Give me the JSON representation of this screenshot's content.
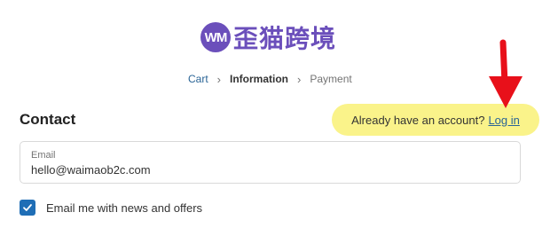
{
  "logo": {
    "badge_text": "WM",
    "brand_text": "歪猫跨境",
    "brand_color": "#6b4fbb"
  },
  "breadcrumb": {
    "items": [
      "Cart",
      "Information",
      "Payment"
    ],
    "separator_icon": "chevron-right-icon"
  },
  "contact": {
    "heading": "Contact",
    "account_prompt": "Already have an account?",
    "login_label": "Log in",
    "highlight_color": "#faf38a",
    "annotation_arrow_color": "#e8101a"
  },
  "email": {
    "label": "Email",
    "value": "hello@waimaob2c.com"
  },
  "newsletter": {
    "label": "Email me with news and offers",
    "checked": true,
    "accent_color": "#1f6eb6"
  }
}
